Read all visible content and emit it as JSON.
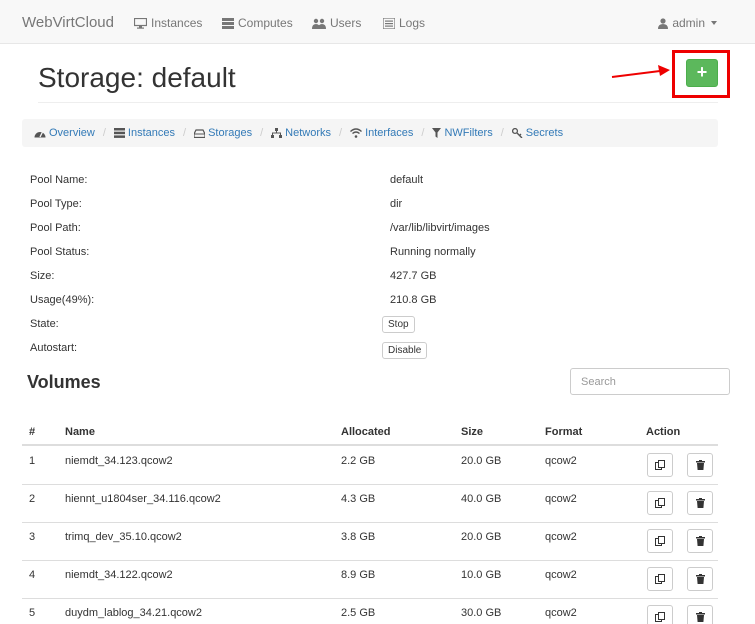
{
  "navbar": {
    "brand": "WebVirtCloud",
    "items": [
      {
        "label": "Instances",
        "icon": "desktop-icon"
      },
      {
        "label": "Computes",
        "icon": "server-icon"
      },
      {
        "label": "Users",
        "icon": "users-icon"
      },
      {
        "label": "Logs",
        "icon": "list-icon"
      }
    ],
    "user": "admin"
  },
  "header": {
    "title": "Storage: default",
    "add_label": "+"
  },
  "breadcrumbs": [
    {
      "label": "Overview",
      "icon": "dashboard-icon"
    },
    {
      "label": "Instances",
      "icon": "list-icon"
    },
    {
      "label": "Storages",
      "icon": "hdd-icon"
    },
    {
      "label": "Networks",
      "icon": "sitemap-icon"
    },
    {
      "label": "Interfaces",
      "icon": "wifi-icon"
    },
    {
      "label": "NWFilters",
      "icon": "filter-icon"
    },
    {
      "label": "Secrets",
      "icon": "key-icon"
    }
  ],
  "info": [
    {
      "label": "Pool Name:",
      "value": "default"
    },
    {
      "label": "Pool Type:",
      "value": "dir"
    },
    {
      "label": "Pool Path:",
      "value": "/var/lib/libvirt/images"
    },
    {
      "label": "Pool Status:",
      "value": "Running normally"
    },
    {
      "label": "Size:",
      "value": "427.7 GB"
    },
    {
      "label": "Usage(49%):",
      "value": "210.8 GB"
    },
    {
      "label": "State:",
      "button": "Stop"
    },
    {
      "label": "Autostart:",
      "button": "Disable"
    }
  ],
  "volumes": {
    "title": "Volumes",
    "search_placeholder": "Search",
    "columns": [
      "#",
      "Name",
      "Allocated",
      "Size",
      "Format",
      "Action"
    ],
    "rows": [
      {
        "num": "1",
        "name": "niemdt_34.123.qcow2",
        "allocated": "2.2 GB",
        "size": "20.0 GB",
        "format": "qcow2"
      },
      {
        "num": "2",
        "name": "hiennt_u1804ser_34.116.qcow2",
        "allocated": "4.3 GB",
        "size": "40.0 GB",
        "format": "qcow2"
      },
      {
        "num": "3",
        "name": "trimq_dev_35.10.qcow2",
        "allocated": "3.8 GB",
        "size": "20.0 GB",
        "format": "qcow2"
      },
      {
        "num": "4",
        "name": "niemdt_34.122.qcow2",
        "allocated": "8.9 GB",
        "size": "10.0 GB",
        "format": "qcow2"
      },
      {
        "num": "5",
        "name": "duydm_lablog_34.21.qcow2",
        "allocated": "2.5 GB",
        "size": "30.0 GB",
        "format": "qcow2"
      }
    ]
  },
  "colors": {
    "accent": "#337ab7",
    "add_button": "#5cb85c",
    "annotation": "#e00000"
  }
}
